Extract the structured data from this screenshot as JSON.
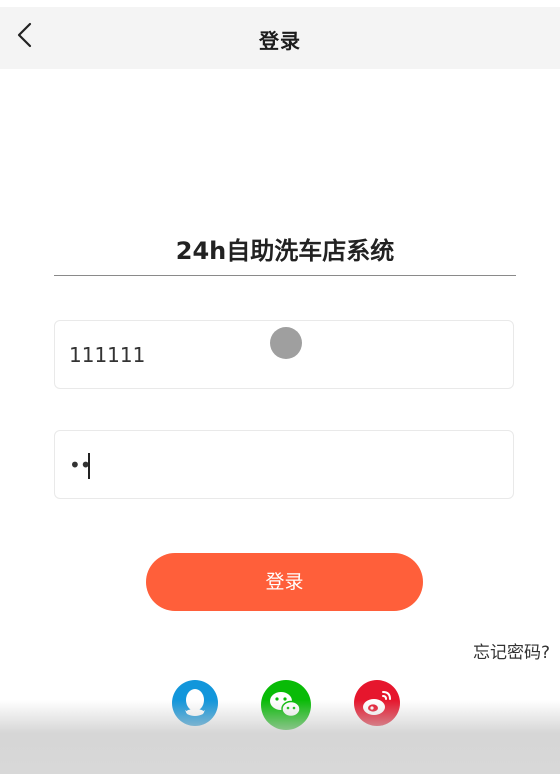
{
  "nav": {
    "title": "登录",
    "back_icon": "chevron-left-icon"
  },
  "app": {
    "title": "24h自助洗车店系统"
  },
  "form": {
    "username_value": "111111",
    "password_value": "••",
    "login_label": "登录",
    "forgot_label": "忘记密码?"
  },
  "social": [
    {
      "name": "qq",
      "icon": "qq-icon",
      "color": "#1296db"
    },
    {
      "name": "wechat",
      "icon": "wechat-icon",
      "color": "#09bb07"
    },
    {
      "name": "weibo",
      "icon": "weibo-icon",
      "color": "#e6162d"
    }
  ],
  "colors": {
    "accent": "#ff5f3a",
    "navbar_bg": "#f4f4f4"
  }
}
